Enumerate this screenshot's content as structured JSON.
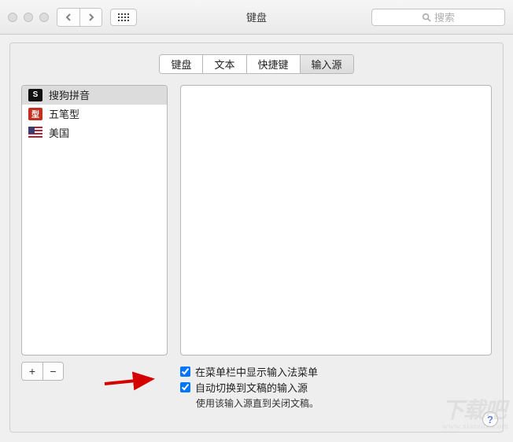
{
  "window": {
    "title": "键盘"
  },
  "search": {
    "placeholder": "搜索"
  },
  "tabs": [
    {
      "key": "keyboard",
      "label": "键盘",
      "active": false
    },
    {
      "key": "text",
      "label": "文本",
      "active": false
    },
    {
      "key": "shortcuts",
      "label": "快捷键",
      "active": false
    },
    {
      "key": "input",
      "label": "输入源",
      "active": true
    }
  ],
  "sources": [
    {
      "key": "sogou",
      "label": "搜狗拼音",
      "iconClass": "sogou",
      "iconText": "S",
      "selected": true
    },
    {
      "key": "wubi",
      "label": "五笔型",
      "iconClass": "wubi",
      "iconText": "型",
      "selected": false
    },
    {
      "key": "us",
      "label": "美国",
      "iconClass": "us",
      "iconText": "",
      "selected": false
    }
  ],
  "addremove": {
    "add": "+",
    "remove": "−"
  },
  "options": {
    "showMenu": {
      "label": "在菜单栏中显示输入法菜单",
      "checked": true
    },
    "autoSwitch": {
      "label": "自动切换到文稿的输入源",
      "checked": true
    },
    "help": "使用该输入源直到关闭文稿。"
  },
  "helpButton": "?",
  "watermark": {
    "main": "下载吧",
    "sub": "www.xiazaiba.com"
  }
}
